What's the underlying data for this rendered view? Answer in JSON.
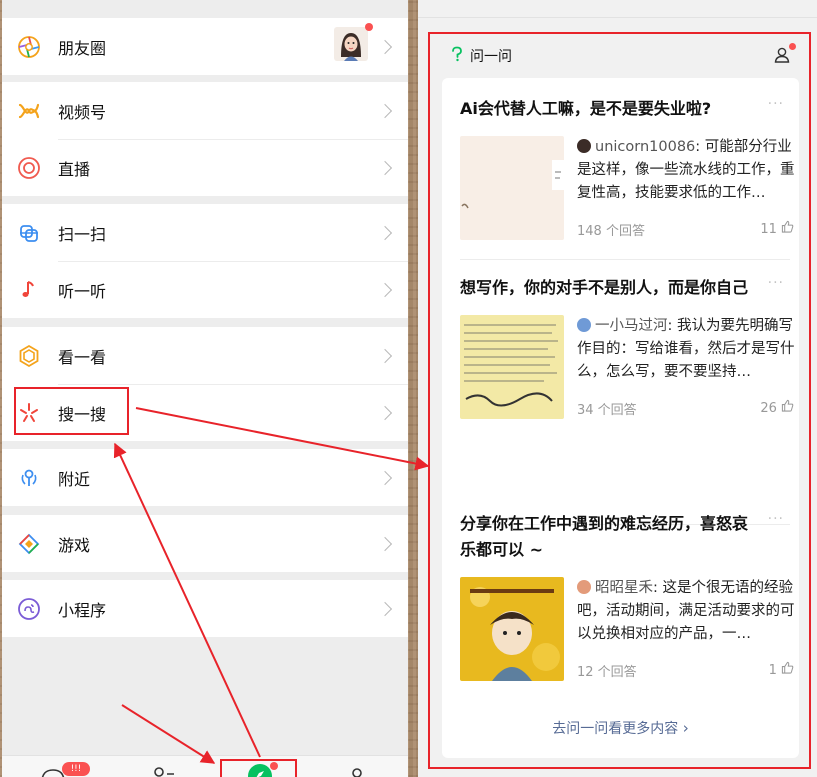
{
  "discover": {
    "items": [
      {
        "key": "moments",
        "label": "朋友圈",
        "icon": "moments-icon"
      },
      {
        "key": "channels",
        "label": "视频号",
        "icon": "channels-icon"
      },
      {
        "key": "live",
        "label": "直播",
        "icon": "live-icon"
      },
      {
        "key": "scan",
        "label": "扫一扫",
        "icon": "scan-icon"
      },
      {
        "key": "listen",
        "label": "听一听",
        "icon": "music-note-icon"
      },
      {
        "key": "top-stories",
        "label": "看一看",
        "icon": "top-stories-icon"
      },
      {
        "key": "search",
        "label": "搜一搜",
        "icon": "search-sparkle-icon"
      },
      {
        "key": "nearby",
        "label": "附近",
        "icon": "nearby-icon"
      },
      {
        "key": "games",
        "label": "游戏",
        "icon": "games-icon"
      },
      {
        "key": "mini-programs",
        "label": "小程序",
        "icon": "mini-program-icon"
      }
    ],
    "tab_badge": "!!!"
  },
  "ask": {
    "title": "问一问",
    "questions": [
      {
        "title": "Ai会代替人工嘛，是不是要失业啦?",
        "author": "unicorn10086",
        "answer": ": 可能部分行业是这样，像一些流水线的工作，重复性高，技能要求低的工作…",
        "answers": "148 个回答",
        "likes": "11"
      },
      {
        "title": "想写作，你的对手不是别人，而是你自己",
        "author": "一小马过河",
        "answer": ": 我认为要先明确写作目的：写给谁看，然后才是写什么，怎么写，要不要坚持…",
        "answers": "34 个回答",
        "likes": "26"
      },
      {
        "title": "分享你在工作中遇到的难忘经历，喜怒哀乐都可以 ~",
        "author": "昭昭星禾",
        "answer": ": 这是个很无语的经验吧，活动期间，满足活动要求的可以兑换相对应的产品，一…",
        "answers": "12 个回答",
        "likes": "1"
      }
    ],
    "see_more": "去问一问看更多内容",
    "colors": {
      "link": "#576b95",
      "highlight": "#e8232a",
      "badge": "#fa5151"
    }
  }
}
